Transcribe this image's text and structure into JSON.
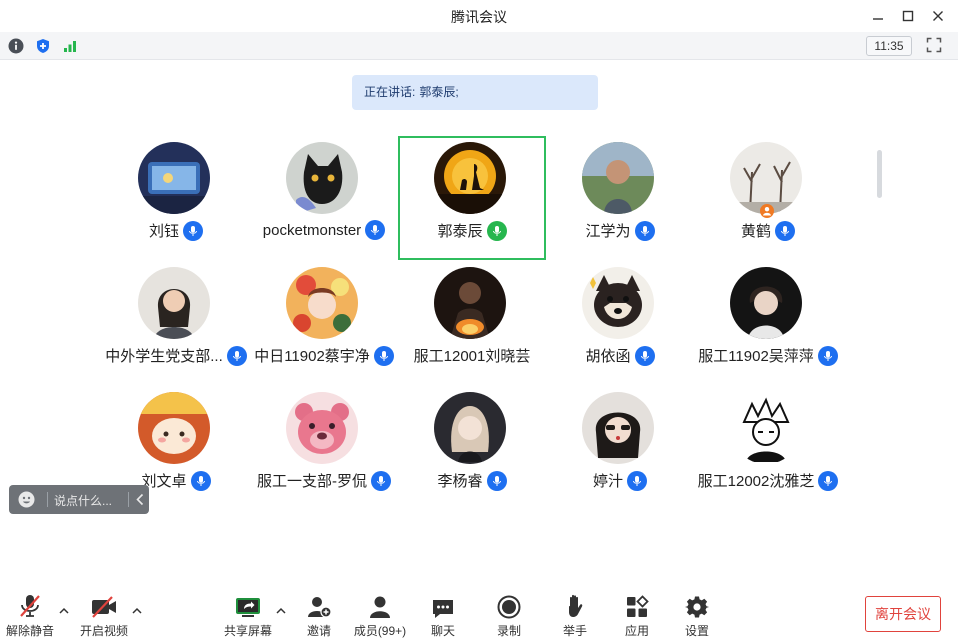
{
  "window": {
    "title": "腾讯会议",
    "clock": "11:35"
  },
  "banner": {
    "prefix": "正在讲话:",
    "speaker": "郭泰辰;"
  },
  "participants": [
    {
      "name": "刘钰"
    },
    {
      "name": "pocketmonster"
    },
    {
      "name": "郭泰辰"
    },
    {
      "name": "江学为"
    },
    {
      "name": "黄鹤"
    },
    {
      "name": "中外学生党支部..."
    },
    {
      "name": "中日11902蔡宇净"
    },
    {
      "name": "服工12001刘晓芸"
    },
    {
      "name": "胡依函"
    },
    {
      "name": "服工11902吴萍萍"
    },
    {
      "name": "刘文卓"
    },
    {
      "name": "服工一支部-罗侃"
    },
    {
      "name": "李杨睿"
    },
    {
      "name": "婷汁"
    },
    {
      "name": "服工12002沈雅芝"
    }
  ],
  "chat": {
    "placeholder": "说点什么..."
  },
  "toolbar": {
    "unmute": "解除静音",
    "start_video": "开启视频",
    "share_screen": "共享屏幕",
    "invite": "邀请",
    "members": "成员(99+)",
    "chat": "聊天",
    "record": "录制",
    "raise_hand": "举手",
    "apps": "应用",
    "settings": "设置",
    "leave": "离开会议"
  },
  "colors": {
    "accent_blue": "#1e6ff0",
    "speaking_green": "#2fbd5e",
    "leave_red": "#e0433d",
    "banner_bg": "#dbe8fb"
  }
}
